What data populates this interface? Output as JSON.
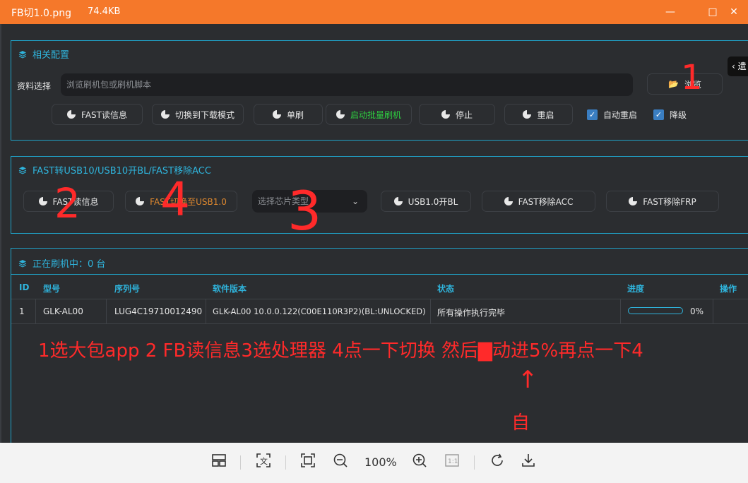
{
  "window": {
    "filename": "FB切1.0.png",
    "filesize": "74.4KB",
    "controls": [
      "—",
      "□",
      "✕"
    ]
  },
  "side_tab": {
    "label": "‹ 遗"
  },
  "config_panel": {
    "title": "相关配置",
    "file_label": "资料选择",
    "file_placeholder": "浏览刷机包或刷机脚本",
    "browse_button": "浏览",
    "buttons": [
      "FAST读信息",
      "切换到下载模式",
      "单刷",
      "启动批量刷机",
      "停止",
      "重启"
    ],
    "checkboxes": [
      {
        "label": "自动重启",
        "checked": true
      },
      {
        "label": "降级",
        "checked": true
      }
    ]
  },
  "fast_panel": {
    "title": "FAST转USB10/USB10开BL/FAST移除ACC",
    "buttons": [
      "FAST读信息",
      "FAST切换至USB1.0",
      "USB1.0开BL",
      "FAST移除ACC",
      "FAST移除FRP"
    ],
    "chip_select_placeholder": "选择芯片类型"
  },
  "flashing_panel": {
    "title": "正在刷机中：0 台",
    "columns": [
      "ID",
      "型号",
      "序列号",
      "软件版本",
      "状态",
      "进度",
      "操作"
    ],
    "rows": [
      {
        "id": "1",
        "model": "GLK-AL00",
        "serial": "LUG4C19710012490",
        "version": "GLK-AL00 10.0.0.122(C00E110R3P2)(BL:UNLOCKED)",
        "status": "所有操作执行完毕",
        "progress": 0,
        "progress_label": "0%"
      }
    ]
  },
  "annotations": {
    "marker_1": "1",
    "marker_2": "2",
    "marker_4": "4",
    "marker_3": "3",
    "instruction_text": "1选大包app 2 FB读信息3选处理器 4点一下切换 然后▇动进5%再点一下4",
    "arrow": "↑",
    "auto_text": "自"
  },
  "viewer_toolbar": {
    "zoom": "100%",
    "icons": [
      "layout-icon",
      "text-recognize-icon",
      "fit-icon",
      "zoom-out-icon",
      "zoom-in-icon",
      "actual-size-icon",
      "rotate-icon",
      "download-icon"
    ]
  },
  "colors": {
    "titlebar": "#f5782a",
    "accent": "#2fb4dc",
    "annotation": "#ff2a2a",
    "green": "#2ecc40"
  }
}
